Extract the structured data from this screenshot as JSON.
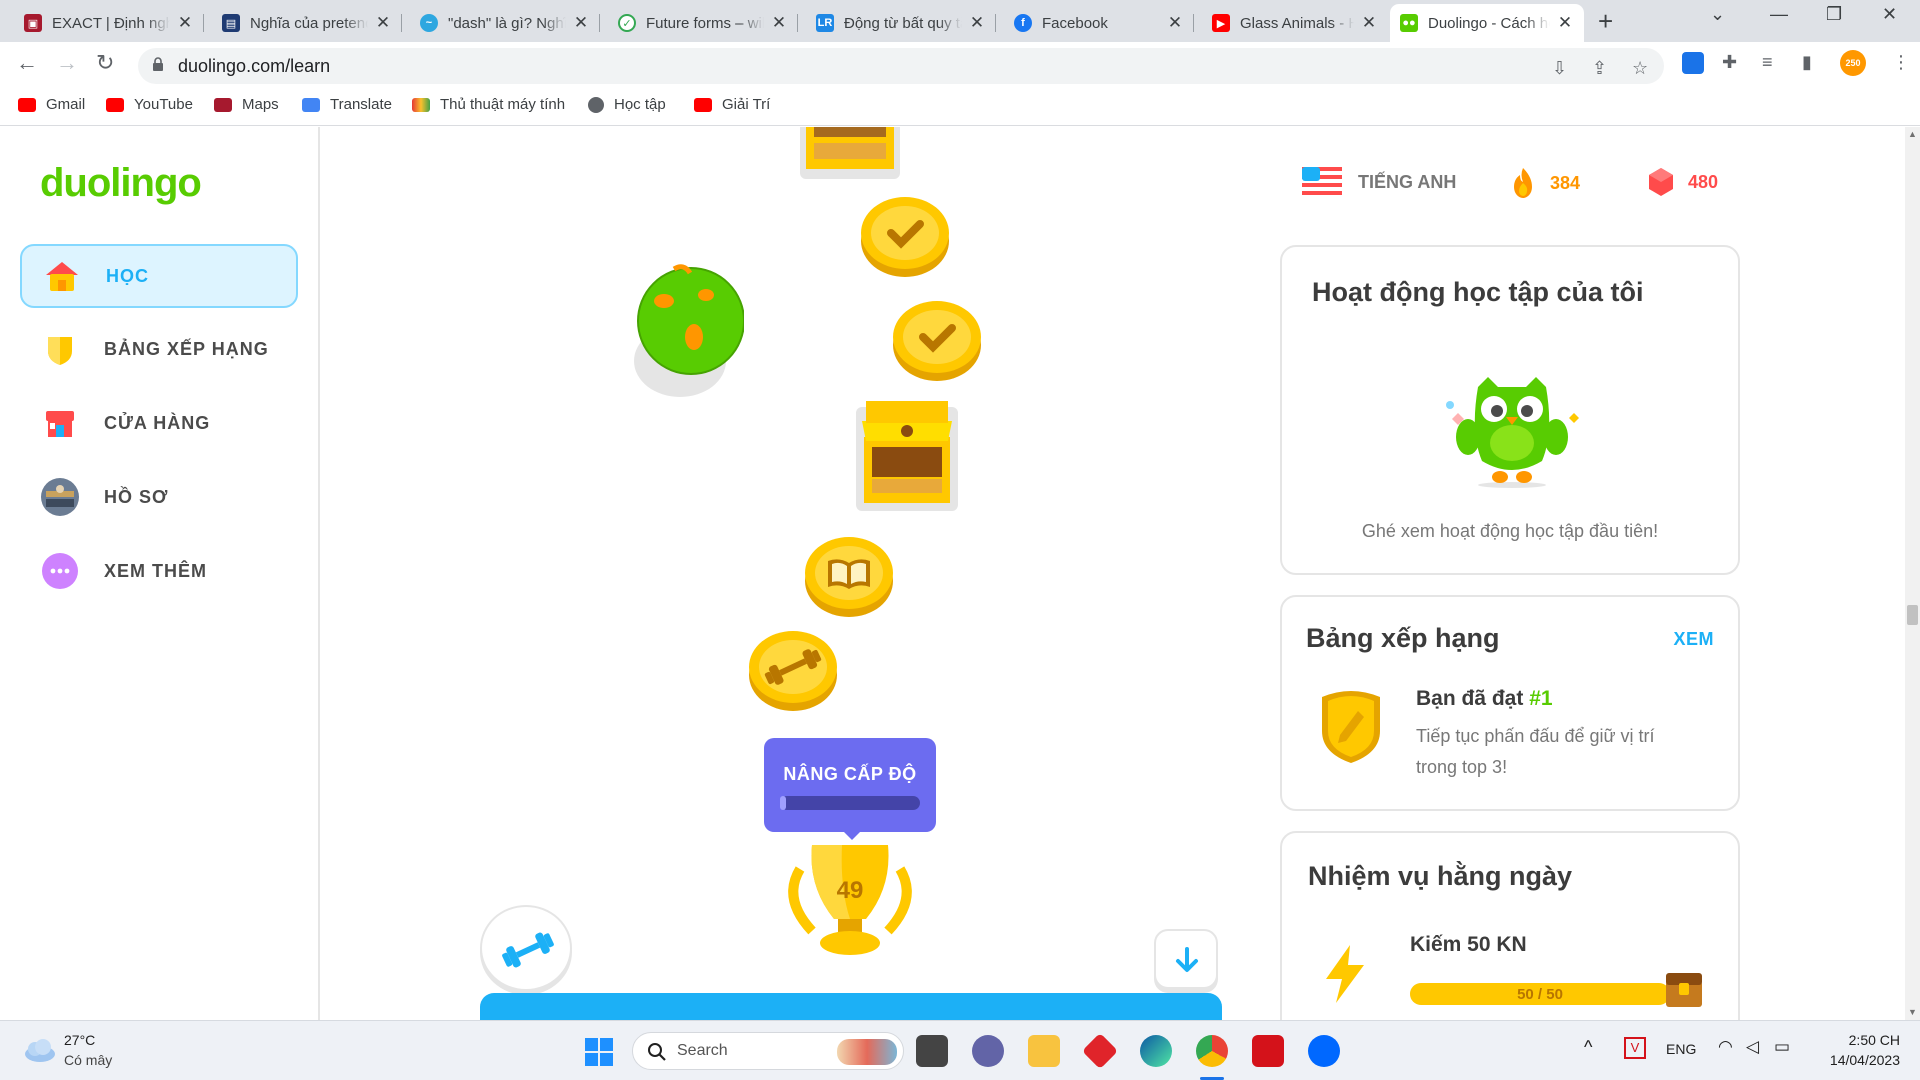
{
  "browser": {
    "tabs": [
      {
        "title": "EXACT | Định nghĩa",
        "close": "✕"
      },
      {
        "title": "Nghĩa của pretend",
        "close": "✕"
      },
      {
        "title": "\"dash\" là gì? Nghĩa",
        "close": "✕"
      },
      {
        "title": "Future forms – will",
        "close": "✕"
      },
      {
        "title": "Động từ bất quy tắc",
        "close": "✕"
      },
      {
        "title": "Facebook",
        "close": "✕"
      },
      {
        "title": "Glass Animals - Heat",
        "close": "✕"
      },
      {
        "title": "Duolingo - Cách học",
        "close": "✕"
      }
    ],
    "new_tab": "+",
    "url": "duolingo.com/learn",
    "bookmarks": [
      "Gmail",
      "YouTube",
      "Maps",
      "Translate",
      "Thủ thuật máy tính",
      "Học tập",
      "Giải Trí"
    ],
    "profile_badge": "250"
  },
  "sidebar": {
    "logo": "duolingo",
    "items": [
      {
        "label": "HỌC"
      },
      {
        "label": "BẢNG XẾP HẠNG"
      },
      {
        "label": "CỬA HÀNG"
      },
      {
        "label": "HỒ SƠ"
      },
      {
        "label": "XEM THÊM"
      }
    ]
  },
  "path": {
    "level_up_label": "NÂNG CẤP ĐỘ",
    "level_up_progress": 0.03,
    "trophy_level": "49"
  },
  "stats": {
    "language": "TIẾNG ANH",
    "streak": "384",
    "gems": "480"
  },
  "activity_card": {
    "title": "Hoạt động học tập của tôi",
    "subtitle": "Ghé xem hoạt động học tập đầu tiên!"
  },
  "leaderboard_card": {
    "title": "Bảng xếp hạng",
    "link": "XEM",
    "rank_prefix": "Bạn đã đạt ",
    "rank": "#1",
    "desc": "Tiếp tục phấn đấu để giữ vị trí trong top 3!"
  },
  "quests_card": {
    "title": "Nhiệm vụ hằng ngày",
    "quest": "Kiếm 50 KN",
    "progress_text": "50 / 50",
    "progress": 1.0
  },
  "taskbar": {
    "weather_temp": "27°C",
    "weather_desc": "Có mây",
    "search_placeholder": "Search",
    "lang": "ENG",
    "time": "2:50 CH",
    "date": "14/04/2023"
  },
  "colors": {
    "duo_green": "#58cc02",
    "duo_blue": "#1cb0f6",
    "gold": "#ffc800",
    "streak": "#ff9600",
    "gem": "#ff4b4b",
    "level_up": "#6c6cf0"
  }
}
